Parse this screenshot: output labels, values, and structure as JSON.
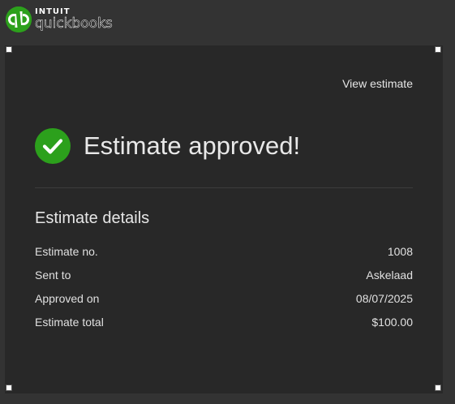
{
  "brand": {
    "intuit": "INTUIT",
    "product": "quickbooks",
    "color": "#2ca01c"
  },
  "card": {
    "view_link": "View estimate",
    "status_title": "Estimate approved!",
    "status_icon": "check-circle-icon",
    "success_color": "#2ca01c",
    "details_title": "Estimate details",
    "details": [
      {
        "label": "Estimate no.",
        "value": "1008"
      },
      {
        "label": "Sent to",
        "value": "Askelaad"
      },
      {
        "label": "Approved on",
        "value": "08/07/2025"
      },
      {
        "label": "Estimate total",
        "value": "$100.00"
      }
    ]
  }
}
